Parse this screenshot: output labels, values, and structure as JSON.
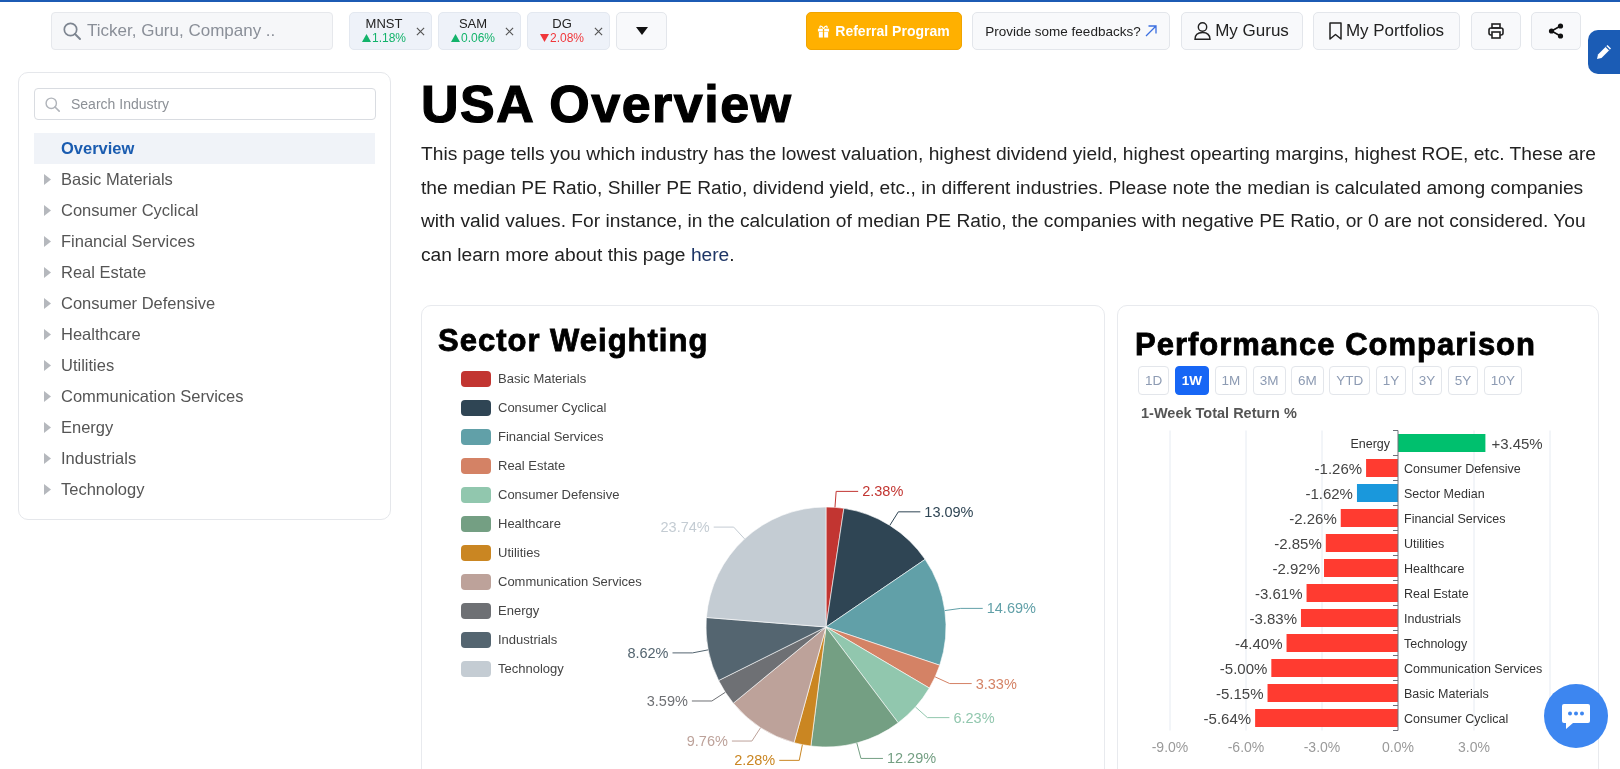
{
  "top_bar": {
    "search": {
      "placeholder": "Ticker, Guru, Company .."
    },
    "tickers": [
      {
        "symbol": "MNST",
        "change": "1.18%",
        "up": true
      },
      {
        "symbol": "SAM",
        "change": "0.06%",
        "up": true
      },
      {
        "symbol": "DG",
        "change": "2.08%",
        "up": false
      }
    ],
    "buttons": [
      {
        "kind": "referral",
        "label": "Referral Program"
      },
      {
        "kind": "feedback",
        "label": "Provide some feedbacks?"
      },
      {
        "kind": "gurus",
        "label": "My Gurus"
      },
      {
        "kind": "portfolios",
        "label": "My Portfolios"
      },
      {
        "kind": "print"
      },
      {
        "kind": "share"
      }
    ]
  },
  "sidebar": {
    "search": {
      "placeholder": "Search Industry"
    },
    "items": [
      {
        "label": "Overview",
        "kind": "page",
        "selected": true
      },
      {
        "label": "Basic Materials",
        "kind": "group",
        "selected": false,
        "expanded": false
      },
      {
        "label": "Consumer Cyclical",
        "kind": "group",
        "selected": false,
        "expanded": false
      },
      {
        "label": "Financial Services",
        "kind": "group",
        "selected": false,
        "expanded": false
      },
      {
        "label": "Real Estate",
        "kind": "group",
        "selected": false,
        "expanded": false
      },
      {
        "label": "Consumer Defensive",
        "kind": "group",
        "selected": false,
        "expanded": false
      },
      {
        "label": "Healthcare",
        "kind": "group",
        "selected": false,
        "expanded": false
      },
      {
        "label": "Utilities",
        "kind": "group",
        "selected": false,
        "expanded": false
      },
      {
        "label": "Communication Services",
        "kind": "group",
        "selected": false,
        "expanded": false
      },
      {
        "label": "Energy",
        "kind": "group",
        "selected": false,
        "expanded": false
      },
      {
        "label": "Industrials",
        "kind": "group",
        "selected": false,
        "expanded": false
      },
      {
        "label": "Technology",
        "kind": "group",
        "selected": false,
        "expanded": false
      }
    ]
  },
  "page": {
    "title": "USA Overview",
    "intro": {
      "text": "This page tells you which industry has the lowest valuation, highest dividend yield, highest opearting margins, highest ROE, etc. These are the median PE Ratio, Shiller PE Ratio, dividend yield, etc., in different industries. Please note the median is calculated among companies with valid values. For instance, in the calculation of median PE Ratio, the companies with negative PE Ratio, or 0 are not considered. You can learn more about this page ",
      "link": "here",
      "after": "."
    }
  },
  "sector_weighting": {
    "chart_data": {
      "type": "pie",
      "title": "Sector Weighting",
      "legend": "left",
      "categories": [
        "Basic Materials",
        "Consumer Cyclical",
        "Financial Services",
        "Real Estate",
        "Consumer Defensive",
        "Healthcare",
        "Utilities",
        "Communication Services",
        "Energy",
        "Industrials",
        "Technology"
      ],
      "values": [
        2.38,
        13.09,
        14.69,
        3.33,
        6.23,
        12.29,
        2.28,
        9.76,
        3.59,
        8.62,
        23.74
      ],
      "value_labels": [
        "2.38%",
        "13.09%",
        "14.69%",
        "3.33%",
        "6.23%",
        "12.29%",
        "2.28%",
        "9.76%",
        "3.59%",
        "8.62%",
        "23.74%"
      ],
      "colors": [
        "#c23531",
        "#2f4554",
        "#61a0a8",
        "#d48265",
        "#91c7ae",
        "#749f83",
        "#ca8622",
        "#bda29a",
        "#6e7074",
        "#546570",
        "#c4ccd3"
      ]
    }
  },
  "performance_comparison": {
    "title": "Performance Comparison",
    "periods": [
      {
        "label": "1D",
        "selected": false
      },
      {
        "label": "1W",
        "selected": true
      },
      {
        "label": "1M",
        "selected": false
      },
      {
        "label": "3M",
        "selected": false
      },
      {
        "label": "6M",
        "selected": false
      },
      {
        "label": "YTD",
        "selected": false
      },
      {
        "label": "1Y",
        "selected": false
      },
      {
        "label": "3Y",
        "selected": false
      },
      {
        "label": "5Y",
        "selected": false
      },
      {
        "label": "10Y",
        "selected": false
      }
    ],
    "chart_data": {
      "type": "bar",
      "orientation": "horizontal",
      "stacked": true,
      "grid": true,
      "title": "1-Week Total Return %",
      "categories": [
        "Energy",
        "Consumer Defensive",
        "Sector Median",
        "Financial Services",
        "Utilities",
        "Healthcare",
        "Real Estate",
        "Industrials",
        "Technology",
        "Communication Services",
        "Basic Materials",
        "Consumer Cyclical"
      ],
      "series": [
        {
          "color": "#00c06e",
          "values": [
            3.45,
            null,
            null,
            null,
            null,
            null,
            null,
            null,
            null,
            null,
            null,
            null
          ]
        },
        {
          "color": "#1a98dc",
          "values": [
            null,
            null,
            -1.62,
            null,
            null,
            null,
            null,
            null,
            null,
            null,
            null,
            null
          ]
        },
        {
          "color": "#ff3b30",
          "values": [
            null,
            -1.26,
            null,
            -2.26,
            -2.85,
            -2.92,
            -3.61,
            -3.83,
            -4.4,
            -5.0,
            -5.15,
            -5.64
          ]
        }
      ],
      "value_labels": [
        "+3.45%",
        "-1.26%",
        "-1.62%",
        "-2.26%",
        "-2.85%",
        "-2.92%",
        "-3.61%",
        "-3.83%",
        "-4.40%",
        "-5.00%",
        "-5.15%",
        "-5.64%"
      ],
      "xlim": [
        -9,
        6
      ],
      "xticks": [
        {
          "value": -9,
          "label": "-9.0%"
        },
        {
          "value": -6,
          "label": "-6.0%"
        },
        {
          "value": -3,
          "label": "-3.0%"
        },
        {
          "value": 0,
          "label": "0.0%"
        },
        {
          "value": 3,
          "label": "3.0%"
        }
      ]
    }
  }
}
